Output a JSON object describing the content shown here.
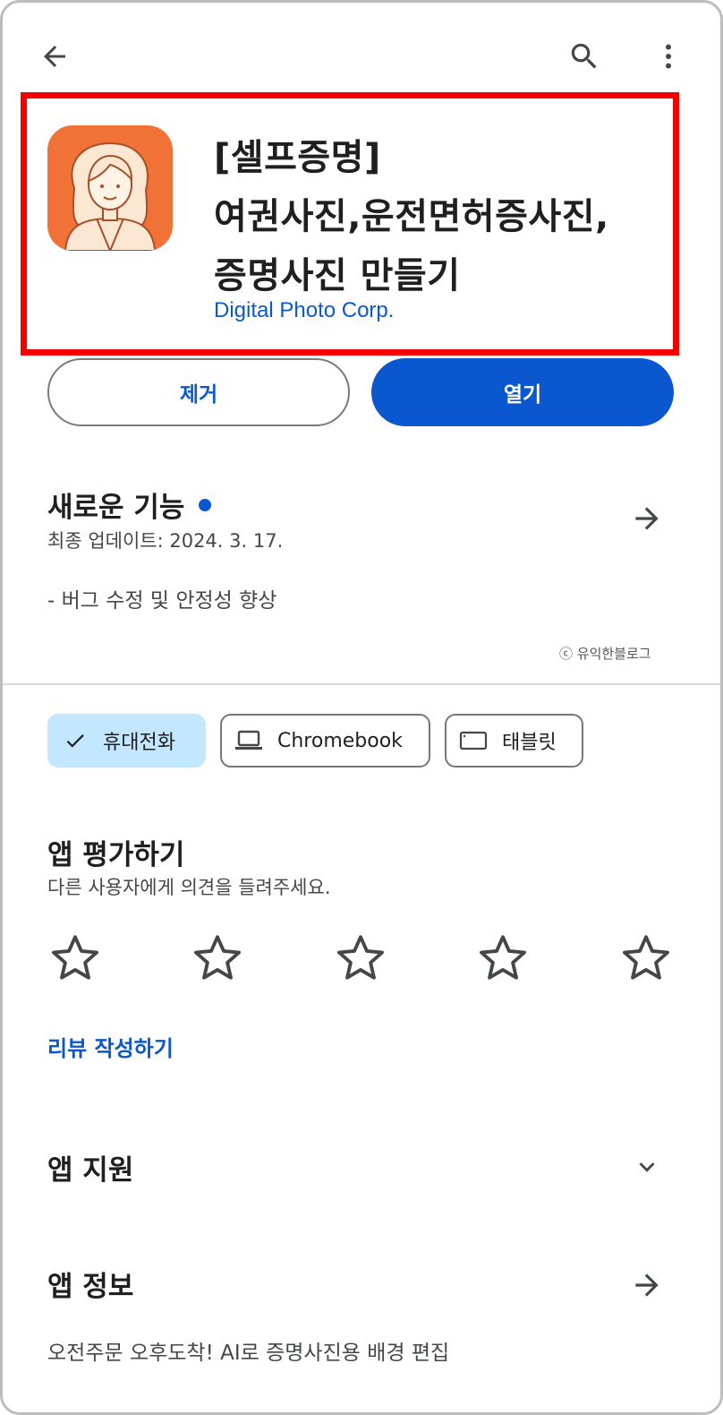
{
  "topbar": {
    "back_icon": "arrow-back-icon",
    "search_icon": "search-icon",
    "more_icon": "more-vert-icon"
  },
  "app": {
    "title_lines": [
      "[셀프증명]",
      "여권사진,운전면허증사진,",
      "증명사진 만들기"
    ],
    "developer": "Digital Photo Corp.",
    "icon": "app-icon-woman-illustration",
    "icon_bg_color": "#f07236"
  },
  "actions": {
    "uninstall_label": "제거",
    "open_label": "열기",
    "accent_color": "#0b57d0"
  },
  "whats_new": {
    "title": "새로운 기능",
    "updated": "최종 업데이트: 2024. 3. 17.",
    "notes": "- 버그 수정 및 안정성 향상",
    "watermark": "ⓒ 유익한블로그"
  },
  "device_chips": [
    {
      "label": "휴대전화",
      "icon": "check-icon",
      "selected": true
    },
    {
      "label": "Chromebook",
      "icon": "laptop-icon",
      "selected": false
    },
    {
      "label": "태블릿",
      "icon": "tablet-icon",
      "selected": false
    }
  ],
  "rate": {
    "title": "앱 평가하기",
    "subtitle": "다른 사용자에게 의견을 들려주세요.",
    "star_count": 5,
    "write_review": "리뷰 작성하기"
  },
  "support": {
    "title": "앱 지원"
  },
  "about": {
    "title": "앱 정보",
    "description": "오전주문 오후도착! AI로 증명사진용 배경 편집"
  }
}
